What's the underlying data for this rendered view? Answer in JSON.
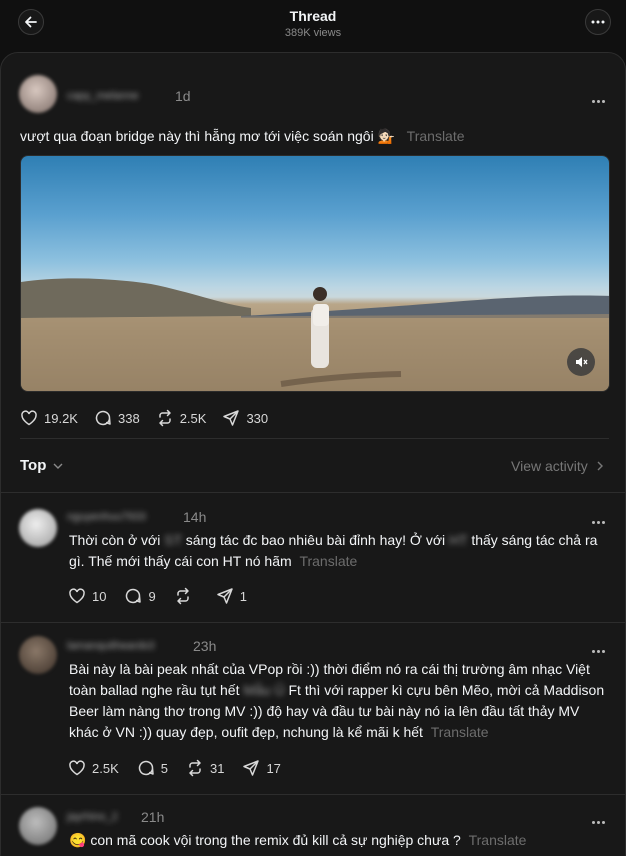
{
  "header": {
    "title": "Thread",
    "views": "389K views"
  },
  "post": {
    "username": "capy_melanne",
    "time": "1d",
    "text": "vượt qua đoạn bridge này thì hẵng mơ tới việc soán ngôi 💁🏻",
    "translate": "Translate",
    "likes": "19.2K",
    "comments": "338",
    "reposts": "2.5K",
    "shares": "330"
  },
  "sort": {
    "label": "Top",
    "view_activity": "View activity"
  },
  "replies": [
    {
      "username": "nguyenhuu7933",
      "time": "14h",
      "text_a": "Thời còn ở với ",
      "blur_a": "ST",
      "text_b": " sáng tác đc bao nhiêu bài đỉnh hay! Ở với ",
      "blur_b": "HT",
      "text_c": " thấy sáng tác chả ra gì. Thế mới thấy cái con HT nó hãm",
      "translate": "Translate",
      "likes": "10",
      "comments": "9",
      "reposts": "",
      "shares": "1"
    },
    {
      "username": "lamanquitheards3",
      "time": "23h",
      "text_a": "Bài này là bài peak nhất của VPop rồi :)) thời điểm nó ra cái thị trường âm nhạc Việt toàn ballad nghe rầu tụt hết",
      "blur_a": "Mẫu Ủ",
      "text_b": "Ft thì với rapper kì cựu bên Mẽo, mời cả Maddison Beer làm nàng thơ trong MV :)) độ hay và đầu tư bài này nó ia lên đầu tất thảy MV khác ở VN :)) quay đẹp, oufit đẹp, nchung là kể mãi k hết",
      "translate": "Translate",
      "likes": "2.5K",
      "comments": "5",
      "reposts": "31",
      "shares": "17"
    },
    {
      "username": "jayrhino_2",
      "time": "21h",
      "text": "😋 con mã cook vội trong the remix đủ kill cả sự nghiệp chưa ?",
      "translate": "Translate"
    }
  ]
}
